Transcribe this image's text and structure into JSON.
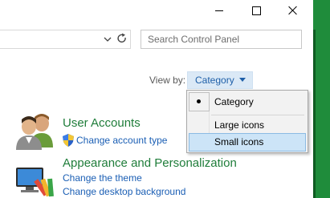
{
  "window": {
    "title_buttons": [
      "minimize",
      "maximize",
      "close"
    ]
  },
  "address": {
    "chevron_icon": "chevron-down-icon",
    "refresh_icon": "refresh-icon"
  },
  "search": {
    "placeholder": "Search Control Panel"
  },
  "view_by": {
    "label": "View by:",
    "selected": "Category"
  },
  "dropdown": {
    "items": [
      {
        "label": "Category",
        "checked": true
      },
      {
        "label": "Large icons",
        "checked": false
      },
      {
        "label": "Small icons",
        "checked": false,
        "highlighted": true
      }
    ]
  },
  "sections": [
    {
      "title": "User Accounts",
      "links": [
        "Change account type"
      ]
    },
    {
      "title": "Appearance and Personalization",
      "links": [
        "Change the theme",
        "Change desktop background"
      ]
    }
  ],
  "colors": {
    "section_title": "#1f7d3a",
    "link": "#1a5eb4",
    "accent_strip": "#1f8c3b",
    "menu_highlight": "#cce4f7"
  }
}
